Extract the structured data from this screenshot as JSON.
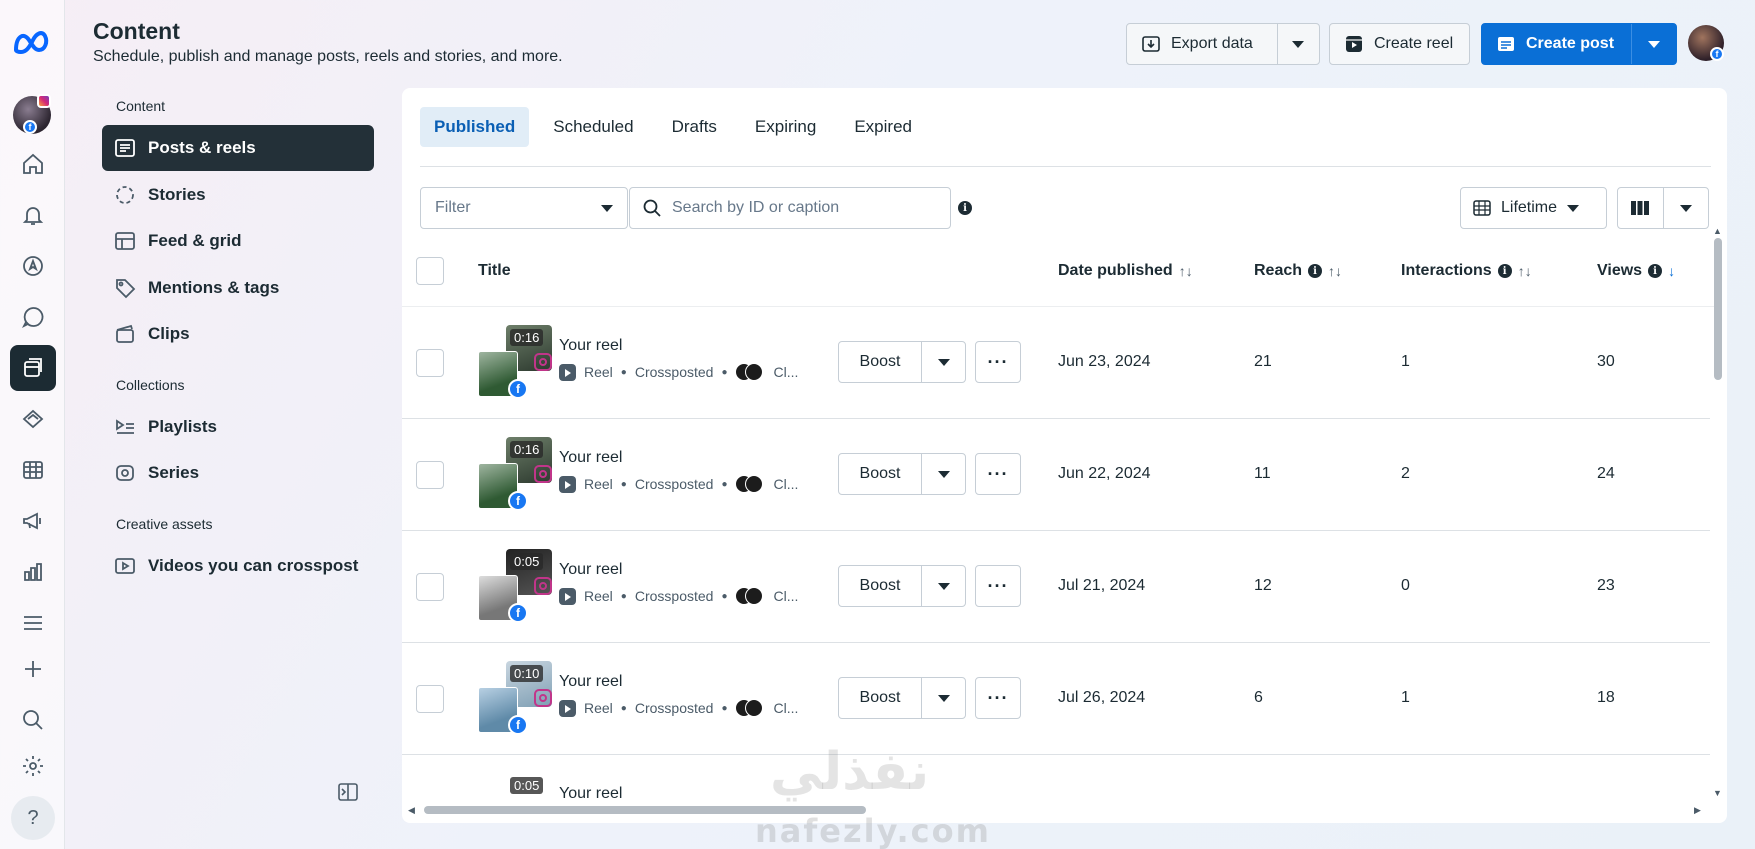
{
  "header": {
    "title": "Content",
    "subtitle": "Schedule, publish and manage posts, reels and stories, and more.",
    "export_label": "Export data",
    "create_reel_label": "Create reel",
    "create_post_label": "Create post"
  },
  "rail": {
    "items": [
      "home-icon",
      "notifications-icon",
      "compass-icon",
      "chat-icon",
      "content-icon",
      "ads-icon",
      "table-icon",
      "megaphone-icon",
      "insights-icon",
      "menu-icon",
      "plus-icon",
      "search-icon",
      "settings-icon"
    ],
    "help_label": "?"
  },
  "nav": {
    "section_content": "Content",
    "posts_reels": "Posts & reels",
    "stories": "Stories",
    "feed_grid": "Feed & grid",
    "mentions_tags": "Mentions & tags",
    "clips": "Clips",
    "section_collections": "Collections",
    "playlists": "Playlists",
    "series": "Series",
    "section_creative": "Creative assets",
    "videos_crosspost": "Videos you can crosspost"
  },
  "tabs": [
    "Published",
    "Scheduled",
    "Drafts",
    "Expiring",
    "Expired"
  ],
  "toolbar": {
    "filter_placeholder": "Filter",
    "search_placeholder": "Search by ID or caption",
    "lifetime_label": "Lifetime"
  },
  "table": {
    "headers": {
      "title": "Title",
      "date": "Date published",
      "reach": "Reach",
      "interactions": "Interactions",
      "views": "Views"
    },
    "rows": [
      {
        "duration": "0:16",
        "title": "Your reel",
        "type": "Reel",
        "status": "Crossposted",
        "collab": "Cl...",
        "boost": "Boost",
        "date": "Jun 23, 2024",
        "reach": "21",
        "interactions": "1",
        "views": "30"
      },
      {
        "duration": "0:16",
        "title": "Your reel",
        "type": "Reel",
        "status": "Crossposted",
        "collab": "Cl...",
        "boost": "Boost",
        "date": "Jun 22, 2024",
        "reach": "11",
        "interactions": "2",
        "views": "24"
      },
      {
        "duration": "0:05",
        "title": "Your reel",
        "type": "Reel",
        "status": "Crossposted",
        "collab": "Cl...",
        "boost": "Boost",
        "date": "Jul 21, 2024",
        "reach": "12",
        "interactions": "0",
        "views": "23"
      },
      {
        "duration": "0:10",
        "title": "Your reel",
        "type": "Reel",
        "status": "Crossposted",
        "collab": "Cl...",
        "boost": "Boost",
        "date": "Jul 26, 2024",
        "reach": "6",
        "interactions": "1",
        "views": "18"
      },
      {
        "duration": "0:05",
        "title": "Your reel"
      }
    ]
  },
  "watermark": {
    "latin": "nafezly.com",
    "arabic": "نفذلي"
  },
  "colors": {
    "primary": "#0a6fd6",
    "active_nav": "#233038",
    "tab_active_bg": "#e1edf7"
  }
}
